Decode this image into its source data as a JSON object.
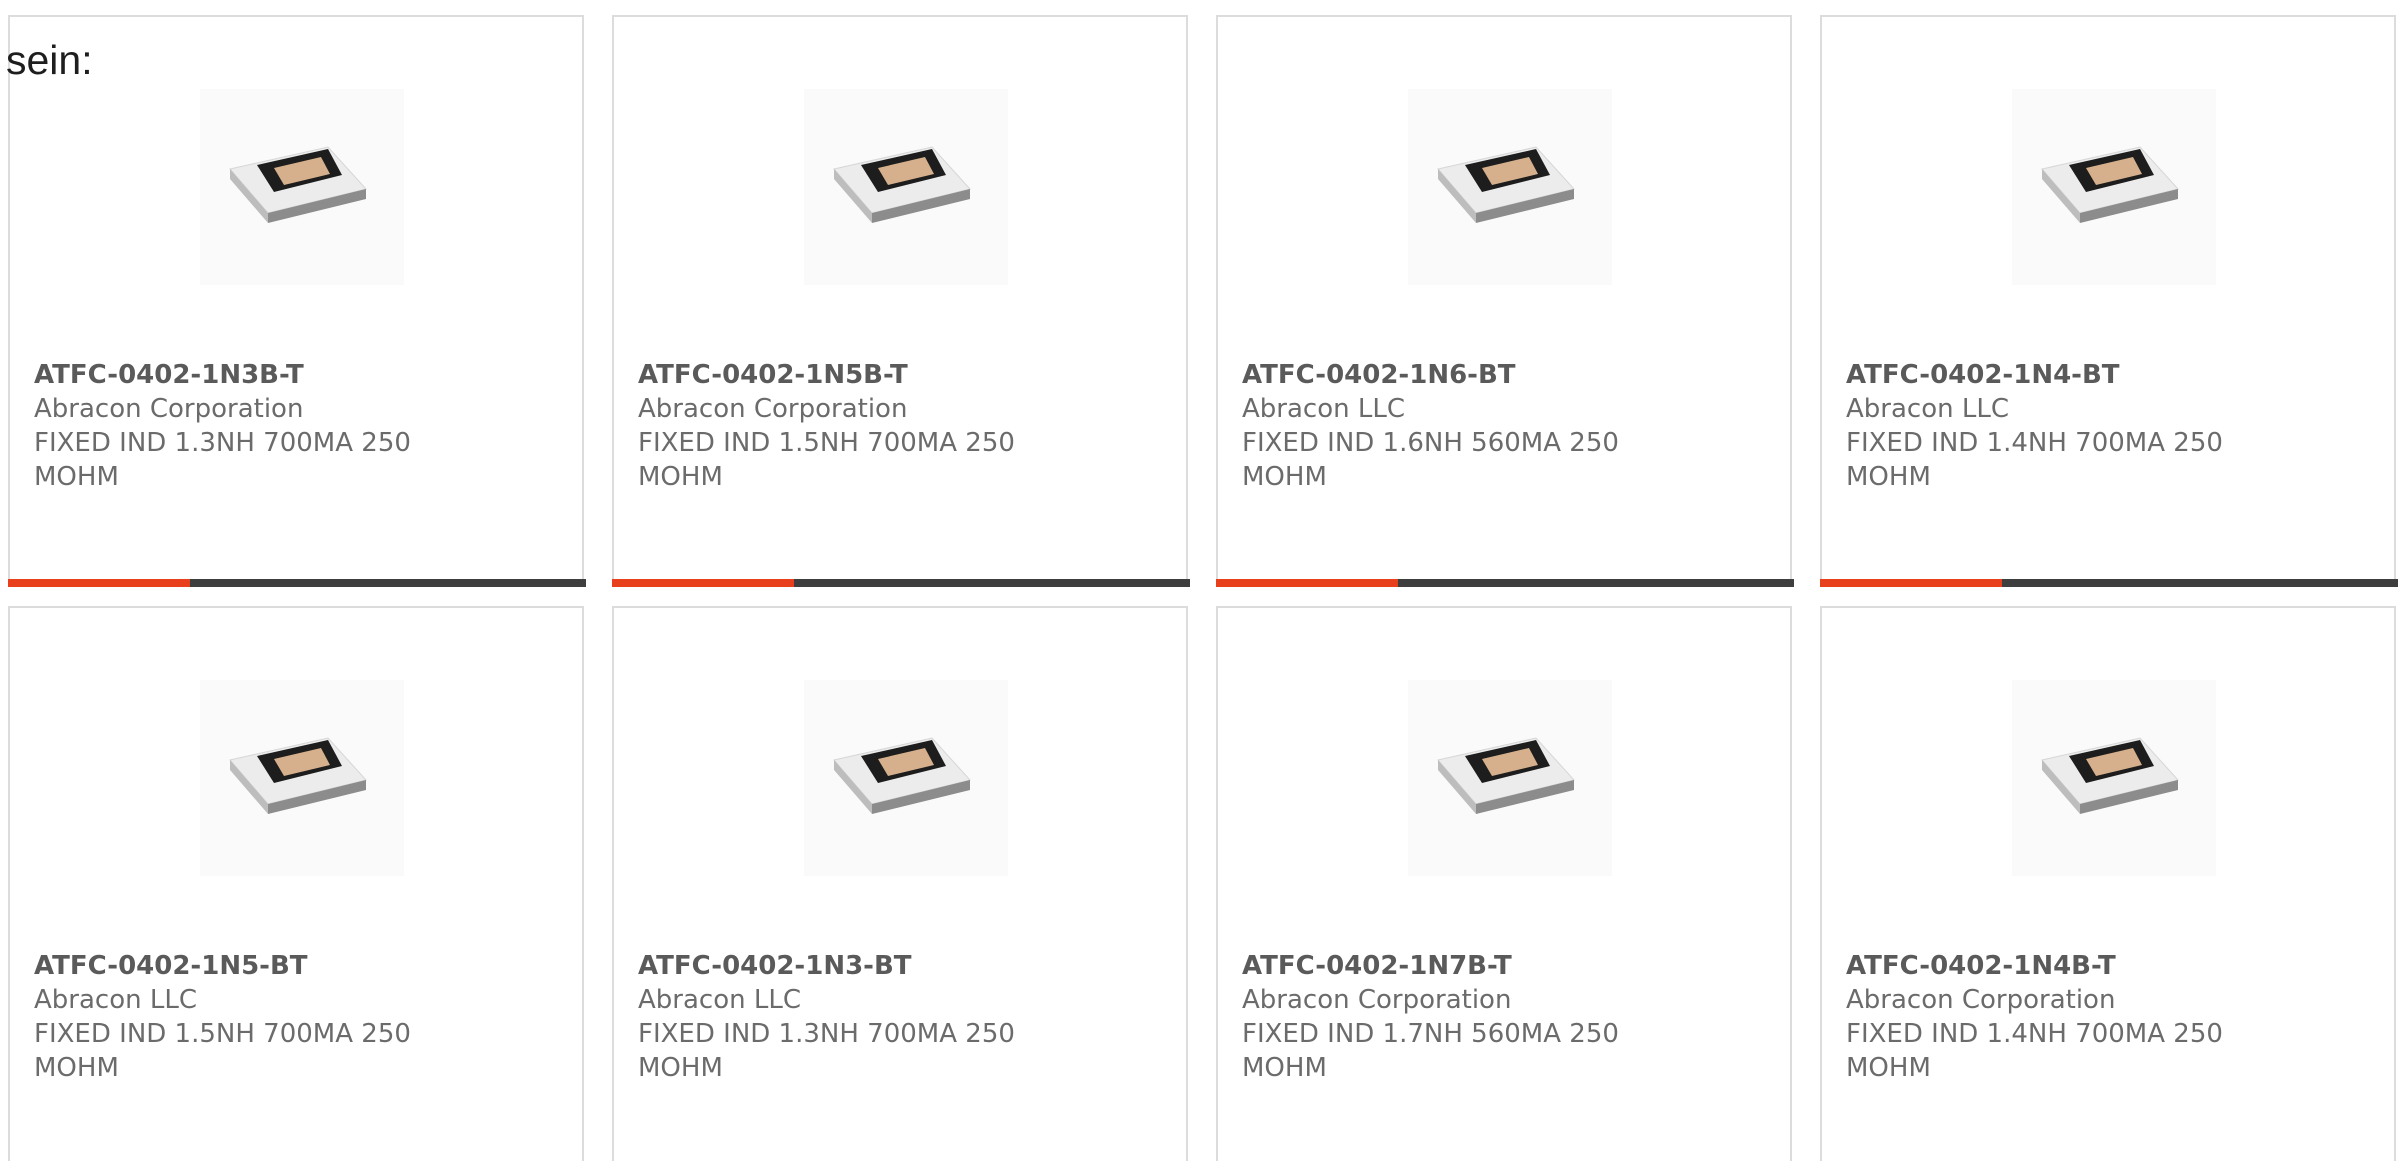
{
  "heading": "sein:",
  "colors": {
    "progress_fill": "#e8401c",
    "progress_track": "#3e3e3e",
    "card_border": "#dcdcdc"
  },
  "products": [
    {
      "part_number": "ATFC-0402-1N3B-T",
      "manufacturer": "Abracon Corporation",
      "description": "FIXED IND 1.3NH 700MA 250 MOHM",
      "image_icon": "smd-inductor-chip-image",
      "progress": 0.315
    },
    {
      "part_number": "ATFC-0402-1N5B-T",
      "manufacturer": "Abracon Corporation",
      "description": "FIXED IND 1.5NH 700MA 250 MOHM",
      "image_icon": "smd-inductor-chip-image",
      "progress": 0.315
    },
    {
      "part_number": "ATFC-0402-1N6-BT",
      "manufacturer": "Abracon LLC",
      "description": "FIXED IND 1.6NH 560MA 250 MOHM",
      "image_icon": "smd-inductor-chip-image",
      "progress": 0.315
    },
    {
      "part_number": "ATFC-0402-1N4-BT",
      "manufacturer": "Abracon LLC",
      "description": "FIXED IND 1.4NH 700MA 250 MOHM",
      "image_icon": "smd-inductor-chip-image",
      "progress": 0.315
    },
    {
      "part_number": "ATFC-0402-1N5-BT",
      "manufacturer": "Abracon LLC",
      "description": "FIXED IND 1.5NH 700MA 250 MOHM",
      "image_icon": "smd-inductor-chip-image",
      "progress": null
    },
    {
      "part_number": "ATFC-0402-1N3-BT",
      "manufacturer": "Abracon LLC",
      "description": "FIXED IND 1.3NH 700MA 250 MOHM",
      "image_icon": "smd-inductor-chip-image",
      "progress": null
    },
    {
      "part_number": "ATFC-0402-1N7B-T",
      "manufacturer": "Abracon Corporation",
      "description": "FIXED IND 1.7NH 560MA 250 MOHM",
      "image_icon": "smd-inductor-chip-image",
      "progress": null
    },
    {
      "part_number": "ATFC-0402-1N4B-T",
      "manufacturer": "Abracon Corporation",
      "description": "FIXED IND 1.4NH 700MA 250 MOHM",
      "image_icon": "smd-inductor-chip-image",
      "progress": null
    }
  ]
}
